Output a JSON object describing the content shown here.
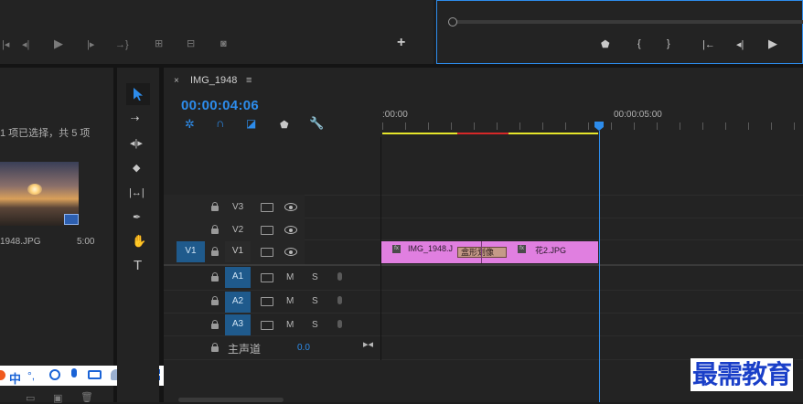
{
  "timeline": {
    "tab_title": "IMG_1948",
    "timecode": "00:00:04:06",
    "ruler_start": ":00:00",
    "ruler_mark": "00:00:05:00"
  },
  "project": {
    "selection_text": "1 项已选择，共 5 项",
    "thumb_name": "1948.JPG",
    "thumb_duration": "5:00"
  },
  "tracks": {
    "video": [
      {
        "name": "V3"
      },
      {
        "name": "V2"
      },
      {
        "name": "V1",
        "source": "V1"
      }
    ],
    "audio": [
      {
        "name": "A1",
        "m": "M",
        "s": "S"
      },
      {
        "name": "A2",
        "m": "M",
        "s": "S"
      },
      {
        "name": "A3",
        "m": "M",
        "s": "S"
      }
    ],
    "master": {
      "label": "主声道",
      "value": "0.0"
    }
  },
  "clips": {
    "clip1": "IMG_1948.J",
    "transition": "盒形划像",
    "clip2": "花2.JPG",
    "fx": "fx"
  },
  "ime": {
    "lang": "中",
    "punct": "°,"
  },
  "watermark": "最需教育",
  "colors": {
    "accent_blue": "#2d8ceb",
    "track_blue": "#1f5a8c",
    "clip_pink": "#e07fe0",
    "render_yellow": "#e6e62b",
    "render_red": "#d62828"
  }
}
